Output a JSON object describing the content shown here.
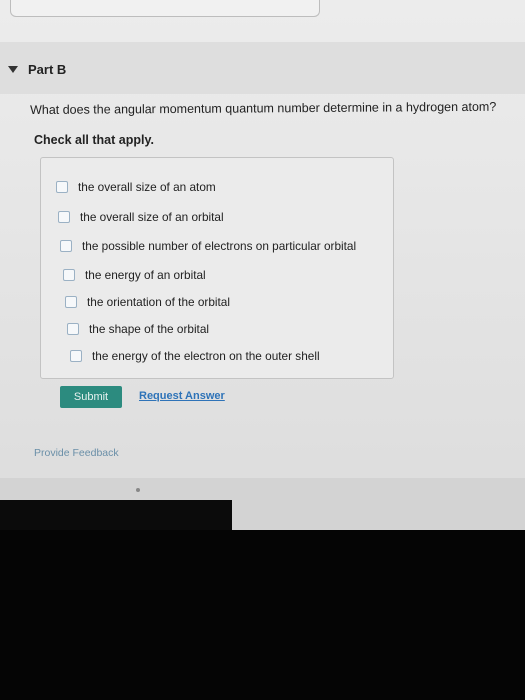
{
  "part": {
    "title": "Part B"
  },
  "question": {
    "text": "What does the angular momentum quantum number determine in a hydrogen atom?",
    "instruction": "Check all that apply."
  },
  "options": [
    {
      "label": "the overall size of an atom",
      "checked": false
    },
    {
      "label": "the overall size of an orbital",
      "checked": false
    },
    {
      "label": "the possible number of electrons on particular orbital",
      "checked": false
    },
    {
      "label": "the energy of an orbital",
      "checked": false
    },
    {
      "label": "the orientation of the orbital",
      "checked": false
    },
    {
      "label": "the shape of the orbital",
      "checked": false
    },
    {
      "label": "the energy of the electron on the outer shell",
      "checked": false
    }
  ],
  "actions": {
    "submit_label": "Submit",
    "request_answer_label": "Request Answer",
    "feedback_label": "Provide Feedback"
  },
  "colors": {
    "submit_bg": "#2c8b7f",
    "link": "#2e73b8",
    "feedback": "#6a8fa8"
  }
}
